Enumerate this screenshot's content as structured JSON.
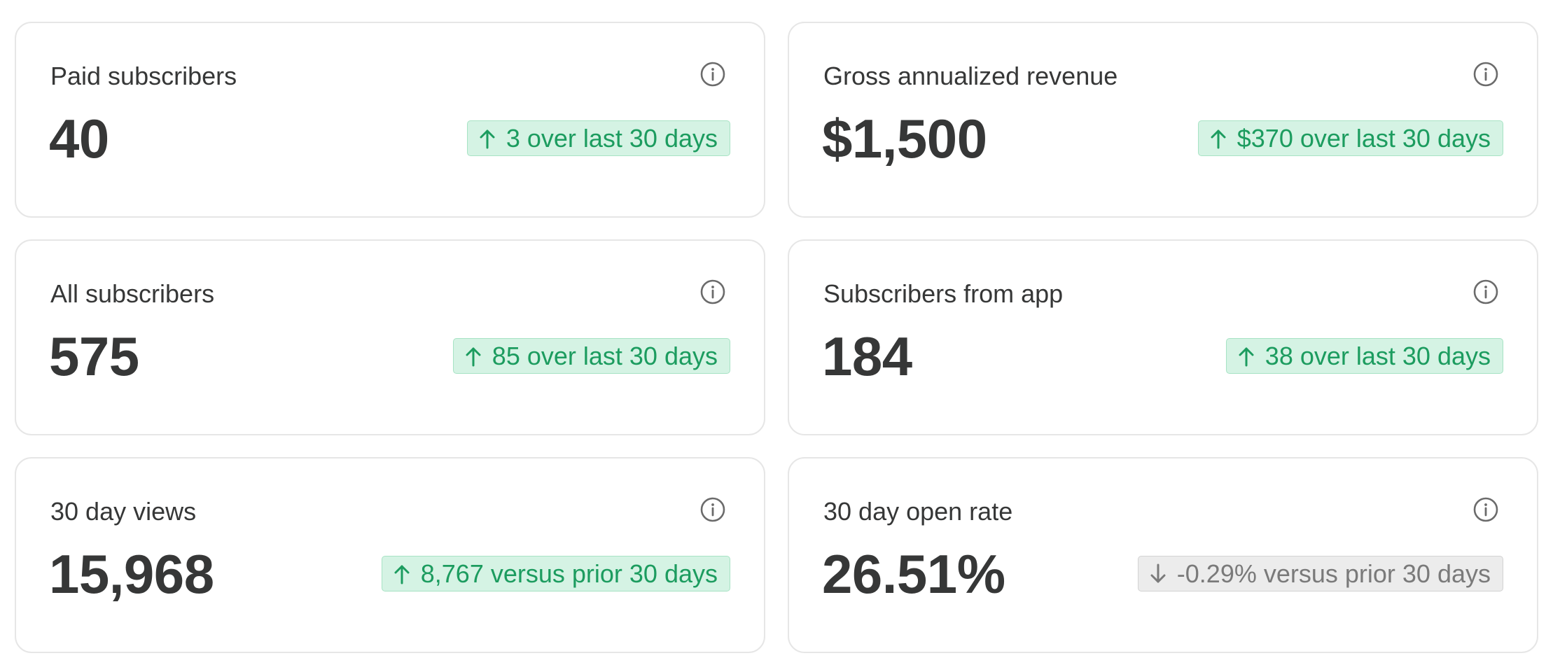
{
  "colors": {
    "card_border": "#e6e6e6",
    "text_primary": "#363737",
    "positive_text": "#1c9c5f",
    "positive_bg": "#d5f3e4",
    "positive_border": "#a7e3c4",
    "neutral_text": "#7a7a7a",
    "neutral_bg": "#ececec",
    "neutral_border": "#d2d2d2"
  },
  "cards": [
    {
      "title": "Paid subscribers",
      "value": "40",
      "change": "3 over last 30 days",
      "trend": "up",
      "icon": "info-icon"
    },
    {
      "title": "Gross annualized revenue",
      "value": "$1,500",
      "change": "$370 over last 30 days",
      "trend": "up",
      "icon": "info-icon"
    },
    {
      "title": "All subscribers",
      "value": "575",
      "change": "85 over last 30 days",
      "trend": "up",
      "icon": "info-icon"
    },
    {
      "title": "Subscribers from app",
      "value": "184",
      "change": "38 over last 30 days",
      "trend": "up",
      "icon": "info-icon"
    },
    {
      "title": "30 day views",
      "value": "15,968",
      "change": "8,767 versus prior 30 days",
      "trend": "up",
      "icon": "info-icon"
    },
    {
      "title": "30 day open rate",
      "value": "26.51%",
      "change": "-0.29% versus prior 30 days",
      "trend": "down",
      "icon": "info-icon"
    }
  ]
}
